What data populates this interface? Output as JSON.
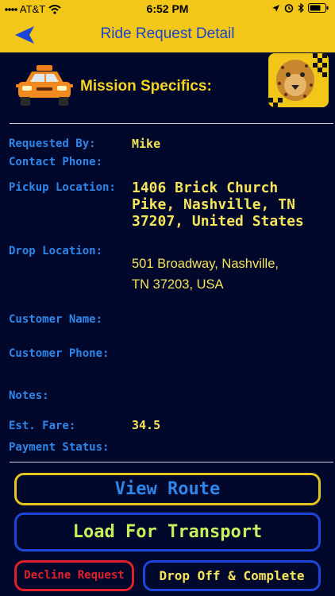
{
  "status_bar": {
    "carrier": "AT&T",
    "time": "6:52 PM"
  },
  "nav": {
    "title": "Ride Request Detail"
  },
  "header": {
    "title": "Mission Specifics:"
  },
  "fields": {
    "requested_by": {
      "label": "Requested By:",
      "value": "Mike"
    },
    "contact_phone": {
      "label": "Contact Phone:",
      "value": ""
    },
    "pickup": {
      "label": "Pickup Location:",
      "value_lines": [
        "1406 Brick Church",
        "Pike, Nashville, TN",
        "37207, United States"
      ]
    },
    "dropoff": {
      "label": "Drop Location:",
      "value_lines": [
        "501 Broadway, Nashville,",
        "TN 37203, USA"
      ]
    },
    "customer_name": {
      "label": "Customer Name:",
      "value": ""
    },
    "customer_phone": {
      "label": "Customer Phone:",
      "value": ""
    },
    "notes": {
      "label": "Notes:",
      "value": ""
    },
    "est_fare": {
      "label": "Est. Fare:",
      "value": "34.5"
    },
    "payment_status": {
      "label": "Payment Status:",
      "value": ""
    }
  },
  "buttons": {
    "view_route": "View Route",
    "load_transport": "Load For Transport",
    "decline": "Decline Request",
    "drop_off": "Drop Off & Complete"
  },
  "colors": {
    "bar": "#f2c719",
    "background": "#02082c",
    "label": "#2f86e8",
    "value": "#f5e35a",
    "decline": "#e0202a"
  },
  "icons": [
    "wifi-icon",
    "location-arrow-icon",
    "alarm-icon",
    "bluetooth-icon",
    "battery-icon",
    "back-arrow-icon",
    "taxi-icon",
    "cheetah-logo"
  ]
}
